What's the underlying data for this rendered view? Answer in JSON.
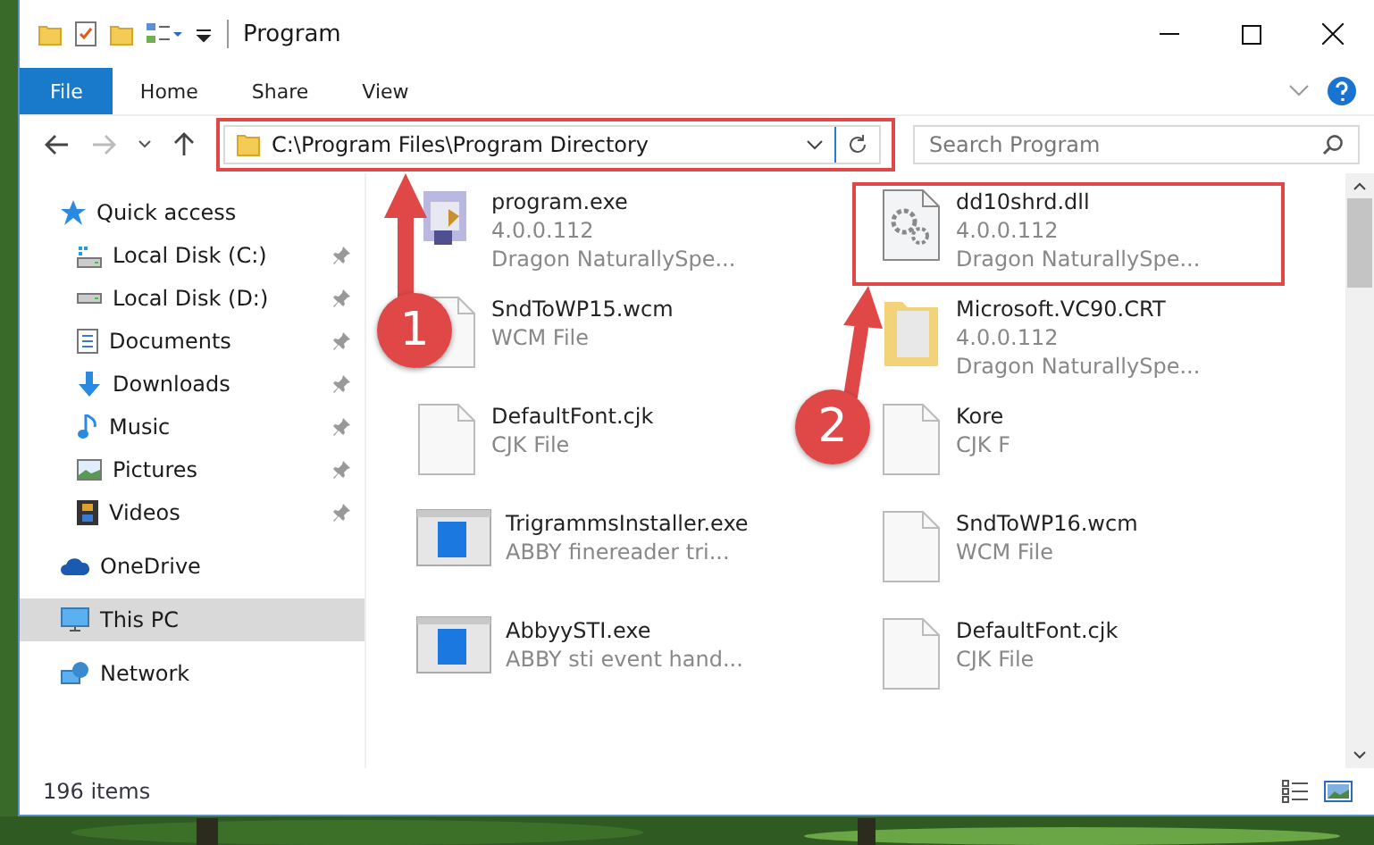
{
  "window": {
    "title": "Program"
  },
  "ribbon": {
    "tabs": [
      {
        "label": "File",
        "selected": true
      },
      {
        "label": "Home",
        "selected": false
      },
      {
        "label": "Share",
        "selected": false
      },
      {
        "label": "View",
        "selected": false
      }
    ]
  },
  "address": {
    "path": "C:\\Program Files\\Program Directory"
  },
  "search": {
    "placeholder": "Search Program"
  },
  "nav": [
    {
      "label": "Quick access",
      "kind": "quick",
      "selected": false,
      "children": [
        {
          "label": "Local Disk (C:)",
          "kind": "disk-c",
          "pinned": true,
          "selected": false
        },
        {
          "label": "Local Disk (D:)",
          "kind": "disk",
          "pinned": true,
          "selected": false
        },
        {
          "label": "Documents",
          "kind": "documents",
          "pinned": true,
          "selected": false
        },
        {
          "label": "Downloads",
          "kind": "downloads",
          "pinned": true,
          "selected": false
        },
        {
          "label": "Music",
          "kind": "music",
          "pinned": true,
          "selected": false
        },
        {
          "label": "Pictures",
          "kind": "pictures",
          "pinned": true,
          "selected": false
        },
        {
          "label": "Videos",
          "kind": "videos",
          "pinned": true,
          "selected": false
        }
      ]
    },
    {
      "label": "OneDrive",
      "kind": "cloud",
      "selected": false
    },
    {
      "label": "This PC",
      "kind": "pc",
      "selected": true
    },
    {
      "label": "Network",
      "kind": "network",
      "selected": false
    }
  ],
  "files": [
    {
      "name": "program.exe",
      "details": [
        "4.0.0.112",
        "Dragon NaturallySpe..."
      ],
      "kind": "app"
    },
    {
      "name": "dd10shrd.dll",
      "details": [
        "4.0.0.112",
        "Dragon NaturallySpe..."
      ],
      "kind": "dll"
    },
    {
      "name": "SndToWP15.wcm",
      "details": [
        "WCM File"
      ],
      "kind": "doc"
    },
    {
      "name": "Microsoft.VC90.CRT",
      "details": [
        "4.0.0.112",
        "Dragon NaturallySpe..."
      ],
      "kind": "folder"
    },
    {
      "name": "DefaultFont.cjk",
      "details": [
        "CJK File"
      ],
      "kind": "doc"
    },
    {
      "name": "Kore",
      "details": [
        "CJK F"
      ],
      "kind": "doc"
    },
    {
      "name": "TrigrammsInstaller.exe",
      "details": [
        "ABBY finereader tri..."
      ],
      "kind": "installer"
    },
    {
      "name": "SndToWP16.wcm",
      "details": [
        "WCM File"
      ],
      "kind": "doc"
    },
    {
      "name": "AbbyySTI.exe",
      "details": [
        "ABBY sti event hand..."
      ],
      "kind": "installer"
    },
    {
      "name": "DefaultFont.cjk",
      "details": [
        "CJK File"
      ],
      "kind": "doc"
    }
  ],
  "status_bar": {
    "count": "196 items"
  },
  "annotations": [
    {
      "label": "1"
    },
    {
      "label": "2"
    }
  ]
}
